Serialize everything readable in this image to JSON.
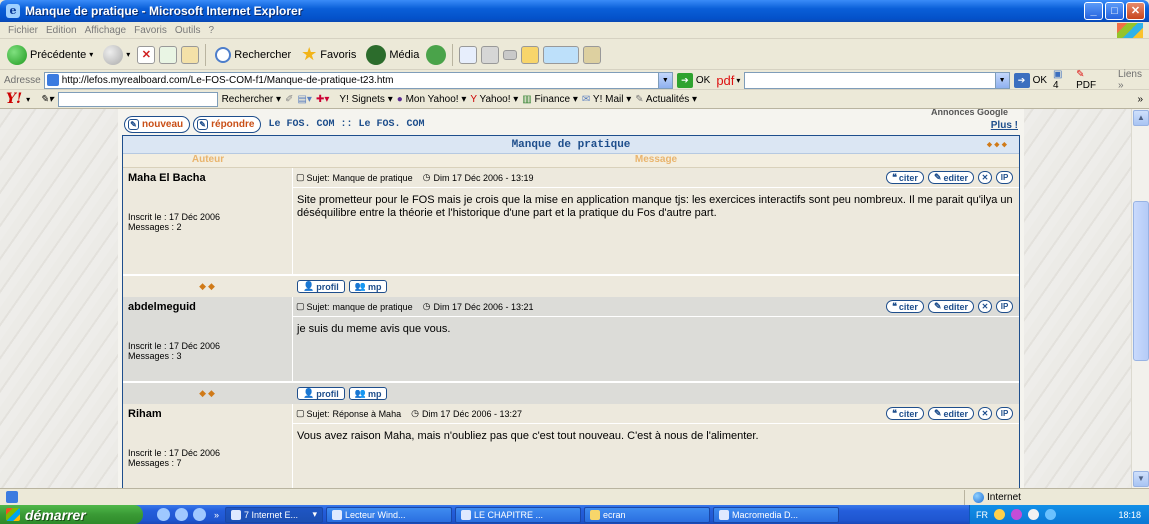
{
  "window": {
    "title": "Manque de pratique - Microsoft Internet Explorer",
    "min": "_",
    "max": "□",
    "close": "✕"
  },
  "menu": [
    "Fichier",
    "Edition",
    "Affichage",
    "Favoris",
    "Outils",
    "?"
  ],
  "toolbar": {
    "back": "Précédente",
    "search": "Rechercher",
    "favorites": "Favoris",
    "media": "Média"
  },
  "address": {
    "label": "Adresse",
    "url": "http://lefos.myrealboard.com/Le-FOS-COM-f1/Manque-de-pratique-t23.htm",
    "go": "OK",
    "pdf": "pdf",
    "ok2": "OK",
    "count": "4",
    "pdfbtn": "PDF",
    "links": "Liens"
  },
  "yahoo": {
    "logo": "Y!",
    "search": "Rechercher",
    "signets": "Y! Signets",
    "myyahoo": "Mon Yahoo!",
    "yahoo": "Yahoo!",
    "finance": "Finance",
    "mail": "Y! Mail",
    "news": "Actualités"
  },
  "forum": {
    "ads": "Annonces Google",
    "btn_new": "nouveau",
    "btn_reply": "répondre",
    "breadcrumb": "Le FOS. COM :: Le FOS. COM",
    "plus": "Plus !",
    "topic_title": "Manque de pratique",
    "col_author": "Auteur",
    "col_message": "Message",
    "subject_label": "Sujet:",
    "btn_quote": "citer",
    "btn_edit": "editer",
    "btn_delete": "✕",
    "btn_ip": "IP",
    "btn_profile": "profil",
    "btn_pm": "mp",
    "posts": [
      {
        "author": "Maha El Bacha",
        "subject": "Manque de pratique",
        "date": "Dim 17 Déc 2006 - 13:19",
        "joined": "Inscrit le : 17 Déc 2006",
        "messages": "Messages : 2",
        "body": "Site prometteur pour le FOS mais je crois que la mise en application manque tjs: les exercices interactifs sont peu nombreux. Il me parait qu'ilya un déséquilibre entre la théorie et l'historique d'une part et la pratique du Fos d'autre part."
      },
      {
        "author": "abdelmeguid",
        "subject": "manque de pratique",
        "date": "Dim 17 Déc 2006 - 13:21",
        "joined": "Inscrit le : 17 Déc 2006",
        "messages": "Messages : 3",
        "body": "je suis du meme avis que vous."
      },
      {
        "author": "Riham",
        "subject": "Réponse à Maha",
        "date": "Dim 17 Déc 2006 - 13:27",
        "joined": "Inscrit le : 17 Déc 2006",
        "messages": "Messages : 7",
        "body": "Vous avez raison Maha, mais n'oubliez pas que c'est tout nouveau. C'est à nous de l'alimenter."
      }
    ]
  },
  "status": {
    "zone": "Internet"
  },
  "taskbar": {
    "start": "démarrer",
    "tasks": [
      "7 Internet E...",
      "Lecteur Wind...",
      "LE CHAPITRE ...",
      "ecran",
      "Macromedia D..."
    ],
    "lang": "FR",
    "clock": "18:18"
  }
}
